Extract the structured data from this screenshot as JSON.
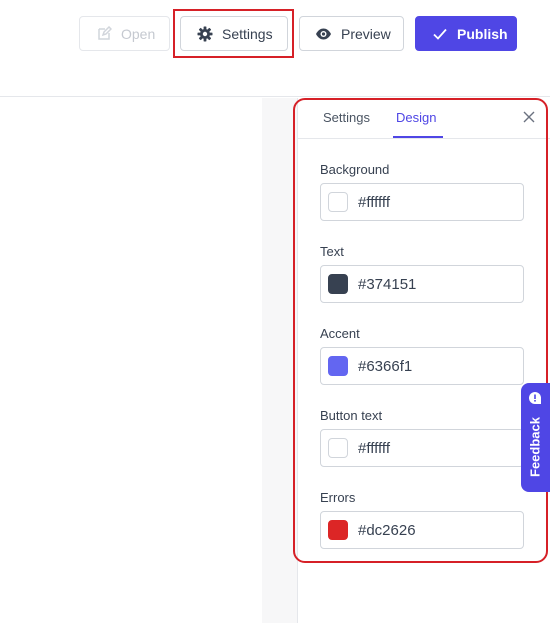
{
  "toolbar": {
    "open_label": "Open",
    "settings_label": "Settings",
    "preview_label": "Preview",
    "publish_label": "Publish"
  },
  "panel": {
    "tabs": [
      {
        "label": "Settings"
      },
      {
        "label": "Design"
      }
    ],
    "fields": [
      {
        "label": "Background",
        "value": "#ffffff"
      },
      {
        "label": "Text",
        "value": "#374151"
      },
      {
        "label": "Accent",
        "value": "#6366f1"
      },
      {
        "label": "Button text",
        "value": "#ffffff"
      },
      {
        "label": "Errors",
        "value": "#dc2626"
      }
    ]
  },
  "feedback": {
    "label": "Feedback"
  },
  "icons": {
    "open": "edit-icon",
    "settings": "gear-icon",
    "preview": "eye-icon",
    "publish": "check-icon",
    "close": "close-icon",
    "feedback": "feedback-icon"
  }
}
